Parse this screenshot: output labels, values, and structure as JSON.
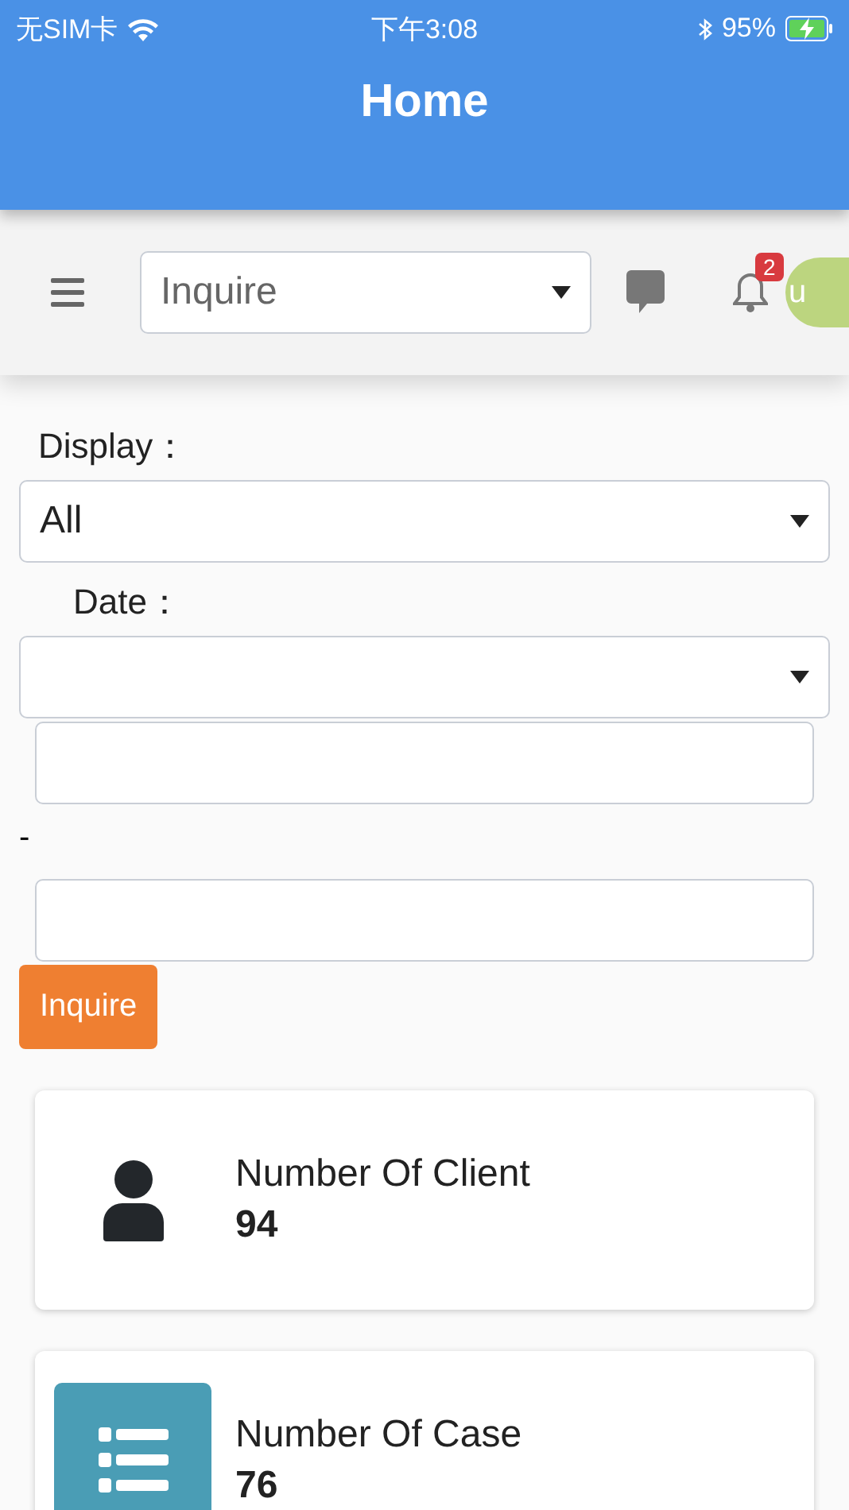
{
  "status_bar": {
    "carrier": "无SIM卡",
    "time": "下午3:08",
    "battery": "95%",
    "charging": true
  },
  "header": {
    "title": "Home"
  },
  "toolbar": {
    "search_select": {
      "value": "Inquire"
    },
    "notifications": {
      "count": "2"
    },
    "avatar": {
      "initials": "u"
    }
  },
  "filters": {
    "display": {
      "label": "Display：",
      "value": "All"
    },
    "date": {
      "label": "Date："
    },
    "separator": "-",
    "button": "Inquire"
  },
  "cards": [
    {
      "kind": "person",
      "label": "Number Of Client",
      "value": "94"
    },
    {
      "kind": "list",
      "label": "Number Of Case",
      "value": "76"
    }
  ]
}
